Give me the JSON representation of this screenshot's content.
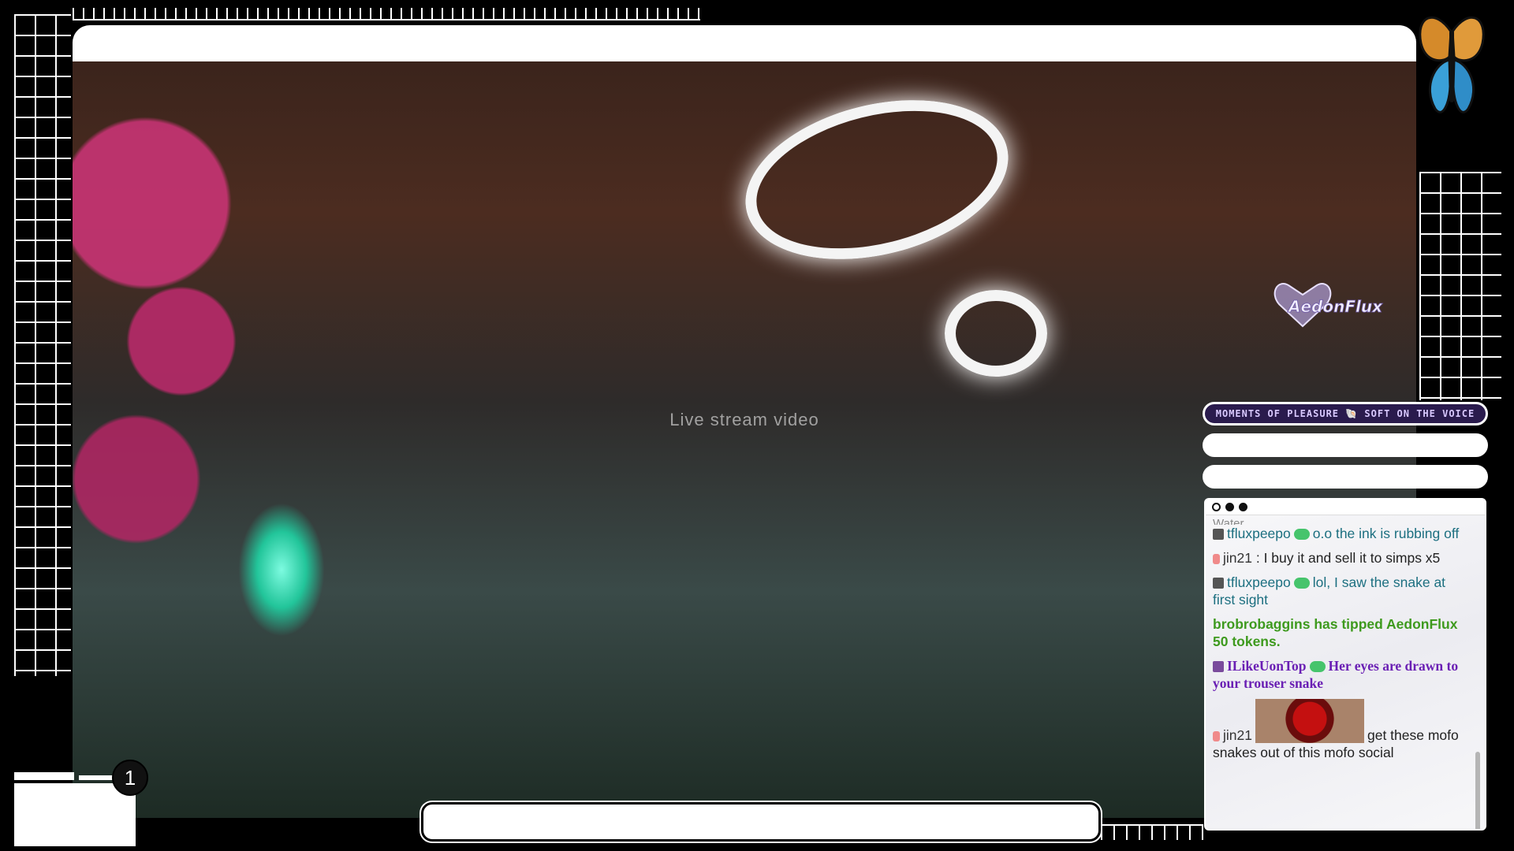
{
  "overlay": {
    "banner_text": "MOMENTS OF PLEASURE 🐚 SOFT ON THE VOICE",
    "watermark_text": "AedonFlux",
    "scene_count": "1"
  },
  "video": {
    "placeholder": "Live stream video"
  },
  "chat": {
    "cutoff_text": "Water",
    "messages": [
      {
        "user": "tfluxpeepo",
        "separator": "",
        "text": "o.o the ink is rubbing off",
        "style": "teal"
      },
      {
        "user": "jin21",
        "separator": " : ",
        "text": "I buy it and sell it to simps x5",
        "style": "plain"
      },
      {
        "user": "tfluxpeepo",
        "separator": "",
        "text": "lol, I saw the snake at first sight",
        "style": "teal"
      },
      {
        "tip": "brobrobaggins has tipped AedonFlux 50 tokens."
      },
      {
        "user": "ILikeUonTop",
        "separator": "",
        "text": "Her eyes are drawn to your trouser snake",
        "style": "purple"
      },
      {
        "user": "jin21",
        "separator": "",
        "text": "get these mofo snakes out of this mofo social",
        "style": "plain"
      }
    ]
  },
  "icons": {
    "butterfly": "butterfly-icon",
    "folder": "folder-icon",
    "window_dots": [
      "circle-outline-icon",
      "circle-filled-icon",
      "circle-filled-icon"
    ],
    "gem_badge": "gem-badge-icon"
  },
  "colors": {
    "frame": "#000000",
    "grid_lines": "#ffffff",
    "banner_bg": "#2a1b4d",
    "banner_text": "#d9c9ff",
    "chat_teal": "#1c6f80",
    "chat_purple": "#6a1fb4",
    "chat_tip_green": "#3e9a1e"
  }
}
